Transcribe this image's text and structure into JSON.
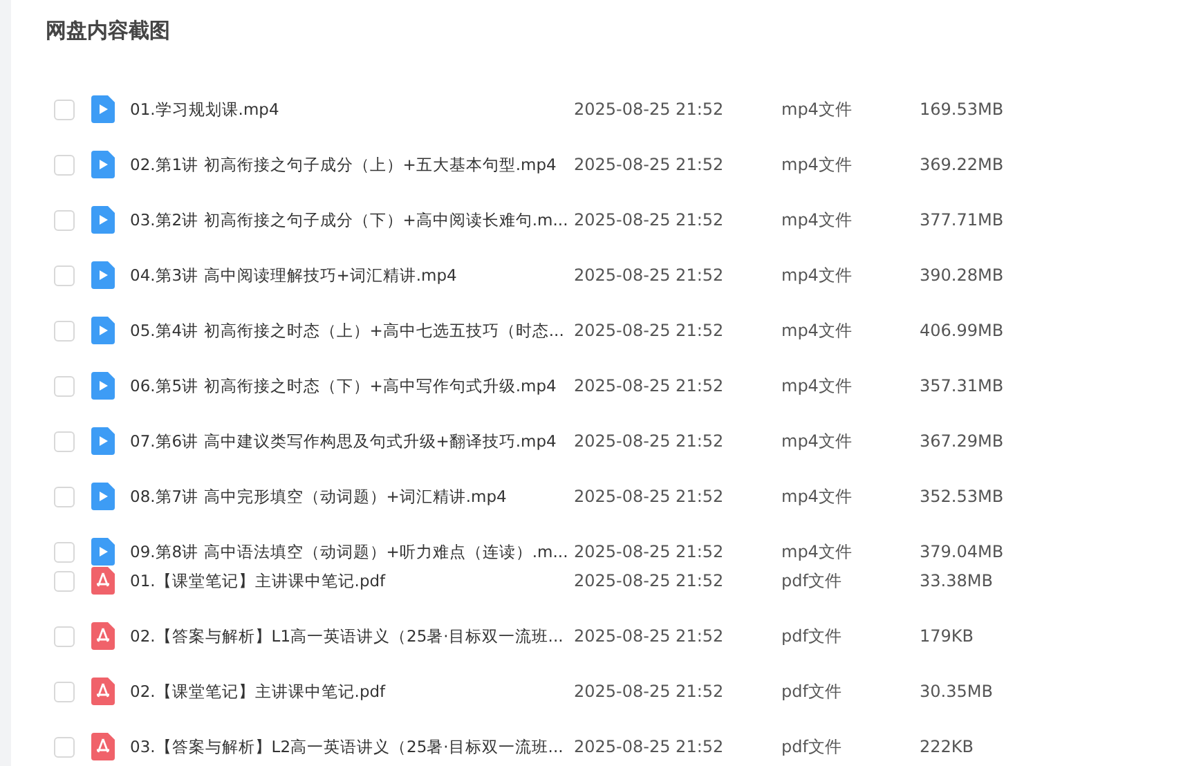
{
  "title": "网盘内容截图",
  "videos": [
    {
      "kind": "video",
      "name": "01.学习规划课.mp4",
      "checked": false,
      "date": "2025-08-25 21:52",
      "type": "mp4文件",
      "size": "169.53MB"
    },
    {
      "kind": "video",
      "name": "02.第1讲 初高衔接之句子成分（上）+五大基本句型.mp4",
      "checked": false,
      "date": "2025-08-25 21:52",
      "type": "mp4文件",
      "size": "369.22MB"
    },
    {
      "kind": "video",
      "name": "03.第2讲 初高衔接之句子成分（下）+高中阅读长难句.m...",
      "checked": false,
      "date": "2025-08-25 21:52",
      "type": "mp4文件",
      "size": "377.71MB"
    },
    {
      "kind": "video",
      "name": "04.第3讲 高中阅读理解技巧+词汇精讲.mp4",
      "checked": false,
      "date": "2025-08-25 21:52",
      "type": "mp4文件",
      "size": "390.28MB"
    },
    {
      "kind": "video",
      "name": "05.第4讲 初高衔接之时态（上）+高中七选五技巧（时态...",
      "checked": false,
      "date": "2025-08-25 21:52",
      "type": "mp4文件",
      "size": "406.99MB"
    },
    {
      "kind": "video",
      "name": "06.第5讲 初高衔接之时态（下）+高中写作句式升级.mp4",
      "checked": false,
      "date": "2025-08-25 21:52",
      "type": "mp4文件",
      "size": "357.31MB"
    },
    {
      "kind": "video",
      "name": "07.第6讲 高中建议类写作构思及句式升级+翻译技巧.mp4",
      "checked": false,
      "date": "2025-08-25 21:52",
      "type": "mp4文件",
      "size": "367.29MB"
    },
    {
      "kind": "video",
      "name": "08.第7讲 高中完形填空（动词题）+词汇精讲.mp4",
      "checked": false,
      "date": "2025-08-25 21:52",
      "type": "mp4文件",
      "size": "352.53MB"
    },
    {
      "kind": "video",
      "name": "09.第8讲 高中语法填空（动词题）+听力难点（连读）.m...",
      "checked": false,
      "date": "2025-08-25 21:52",
      "type": "mp4文件",
      "size": "379.04MB"
    }
  ],
  "documents": [
    {
      "kind": "pdf",
      "name": "01.【课堂笔记】主讲课中笔记.pdf",
      "checked": false,
      "date": "2025-08-25 21:52",
      "type": "pdf文件",
      "size": "33.38MB"
    },
    {
      "kind": "pdf",
      "name": "02.【答案与解析】L1高一英语讲义（25暑·目标双一流班...",
      "checked": false,
      "date": "2025-08-25 21:52",
      "type": "pdf文件",
      "size": "179KB"
    },
    {
      "kind": "pdf",
      "name": "02.【课堂笔记】主讲课中笔记.pdf",
      "checked": false,
      "date": "2025-08-25 21:52",
      "type": "pdf文件",
      "size": "30.35MB"
    },
    {
      "kind": "pdf",
      "name": "03.【答案与解析】L2高一英语讲义（25暑·目标双一流班...",
      "checked": false,
      "date": "2025-08-25 21:52",
      "type": "pdf文件",
      "size": "222KB"
    }
  ]
}
